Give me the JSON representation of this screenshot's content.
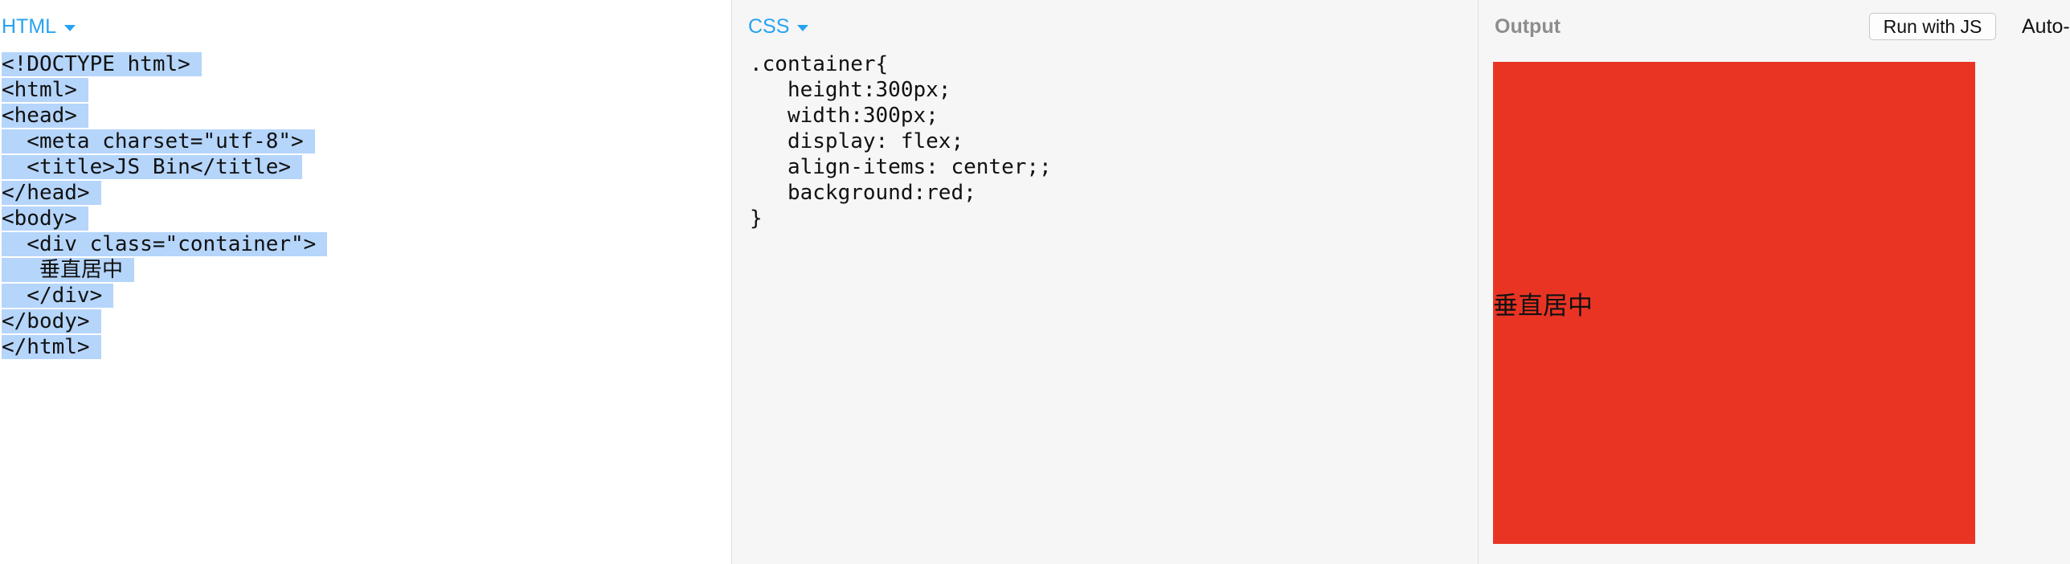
{
  "html_panel": {
    "label": "HTML",
    "lines": [
      "<!DOCTYPE html>",
      "<html>",
      "<head>",
      "  <meta charset=\"utf-8\">",
      "  <title>JS Bin</title>",
      "</head>",
      "<body>",
      "  <div class=\"container\">",
      "   垂直居中",
      "  </div>",
      "</body>",
      "</html>"
    ]
  },
  "css_panel": {
    "label": "CSS",
    "lines": [
      ".container{",
      "   height:300px;",
      "   width:300px;",
      "   display: flex;",
      "   align-items: center;;",
      "   background:red;",
      "}"
    ]
  },
  "output_panel": {
    "label": "Output",
    "run_button": "Run with JS",
    "auto_run": "Auto-",
    "rendered_text": "垂直居中",
    "box_color": "#e93424"
  },
  "colors": {
    "accent": "#27a3f0",
    "selection": "#b5d5fb"
  }
}
